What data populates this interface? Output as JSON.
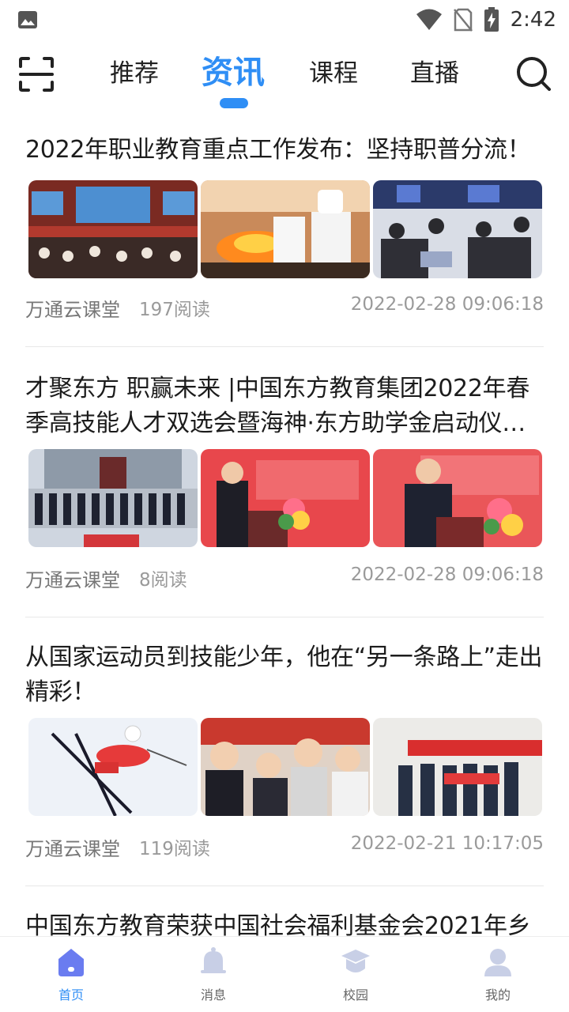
{
  "status_bar": {
    "time": "2:42"
  },
  "top_tabs": [
    {
      "label": "推荐",
      "active": false
    },
    {
      "label": "资讯",
      "active": true
    },
    {
      "label": "课程",
      "active": false
    },
    {
      "label": "直播",
      "active": false
    }
  ],
  "articles": [
    {
      "title": "2022年职业教育重点工作发布：坚持职普分流！",
      "source": "万通云课堂",
      "reads": "197阅读",
      "date": "2022-02-28 09:06:18"
    },
    {
      "title": "才聚东方 职赢未来 |中国东方教育集团2022年春季高技能人才双选会暨海神·东方助学金启动仪…",
      "source": "万通云课堂",
      "reads": "8阅读",
      "date": "2022-02-28 09:06:18"
    },
    {
      "title": "从国家运动员到技能少年，他在“另一条路上”走出精彩！",
      "source": "万通云课堂",
      "reads": "119阅读",
      "date": "2022-02-21 10:17:05"
    },
    {
      "title": "中国东方教育荣获中国社会福利基金会2021年乡"
    }
  ],
  "bottom_nav": [
    {
      "label": "首页",
      "active": true,
      "icon": "home-icon"
    },
    {
      "label": "消息",
      "active": false,
      "icon": "bell-icon"
    },
    {
      "label": "校园",
      "active": false,
      "icon": "graduation-cap-icon"
    },
    {
      "label": "我的",
      "active": false,
      "icon": "user-icon"
    }
  ],
  "colors": {
    "accent": "#2f8ef5",
    "bottom_active": "#6a7cf0",
    "icon_inactive": "#c8cfe6"
  }
}
